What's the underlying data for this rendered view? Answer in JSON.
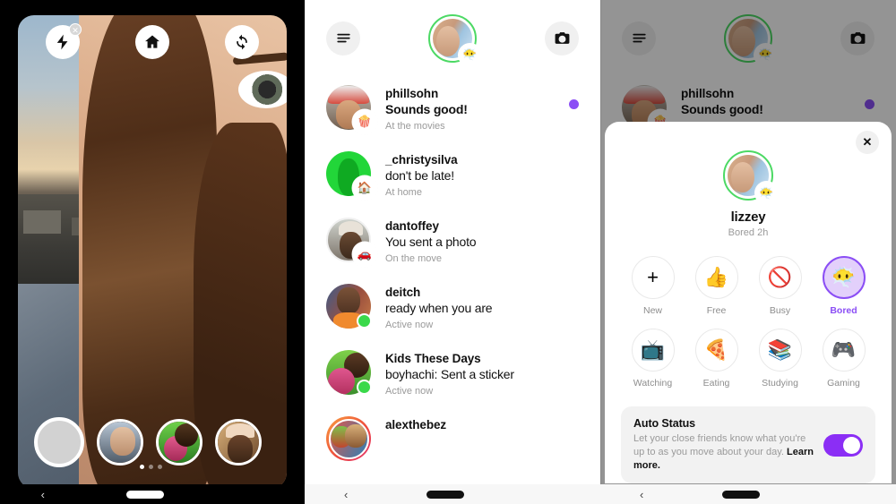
{
  "camera": {
    "flash_icon": "flash-off-icon",
    "home_icon": "home-icon",
    "flip_icon": "flip-camera-icon",
    "shutter_label": "",
    "tray": [
      {
        "name": "tray-avatar-1"
      },
      {
        "name": "tray-avatar-2"
      },
      {
        "name": "tray-avatar-3"
      }
    ]
  },
  "inbox": {
    "menu_icon": "hamburger-menu-icon",
    "camera_icon": "camera-icon",
    "me": {
      "status_emoji": "😶‍🌫️",
      "ring_color": "#4cd964"
    },
    "chats": [
      {
        "name": "phillsohn",
        "message": "Sounds good!",
        "status": "At the movies",
        "emoji": "🍿",
        "unread": true,
        "bold": true,
        "avatar_class": "a-phill"
      },
      {
        "name": "_christysilva",
        "message": "don't be late!",
        "status": "At home",
        "emoji": "🏠",
        "unread": false,
        "bold": false,
        "avatar_class": "a-christy"
      },
      {
        "name": "dantoffey",
        "message": "You sent a photo",
        "status": "On the move",
        "emoji": "🚗",
        "unread": false,
        "bold": false,
        "avatar_class": "a-dantoffey"
      },
      {
        "name": "deitch",
        "message": "ready when you are",
        "status": "Active now",
        "emoji": "",
        "online": true,
        "unread": false,
        "bold": false,
        "avatar_class": "a-deitch"
      },
      {
        "name": "Kids These Days",
        "message": "boyhachi: Sent a sticker",
        "status": "Active now",
        "emoji": "",
        "online": true,
        "unread": false,
        "bold": false,
        "avatar_class": "a-kids"
      },
      {
        "name": "alexthebez",
        "message": "",
        "status": "",
        "emoji": "",
        "unread": false,
        "bold": false,
        "avatar_class": "a-alex",
        "story_ring": true
      }
    ]
  },
  "status_sheet": {
    "close_label": "✕",
    "username": "lizzey",
    "current_status": "Bored 2h",
    "profile_emoji": "😶‍🌫️",
    "options": [
      {
        "label": "New",
        "emoji": "+",
        "selected": false
      },
      {
        "label": "Free",
        "emoji": "👍",
        "selected": false
      },
      {
        "label": "Busy",
        "emoji": "🚫",
        "selected": false
      },
      {
        "label": "Bored",
        "emoji": "😶‍🌫️",
        "selected": true
      },
      {
        "label": "Watching",
        "emoji": "📺",
        "selected": false
      },
      {
        "label": "Eating",
        "emoji": "🍕",
        "selected": false
      },
      {
        "label": "Studying",
        "emoji": "📚",
        "selected": false
      },
      {
        "label": "Gaming",
        "emoji": "🎮",
        "selected": false
      }
    ],
    "auto_status": {
      "title": "Auto Status",
      "description": "Let your close friends know what you're up to as you move about your day. ",
      "link": "Learn more.",
      "enabled": true,
      "accent_color": "#8b2ef5"
    }
  },
  "navbar": {
    "back_icon": "‹",
    "pill_label": ""
  },
  "colors": {
    "accent_purple": "#8b4ef5",
    "online_green": "#3ad94a",
    "ring_green": "#4cd964"
  }
}
